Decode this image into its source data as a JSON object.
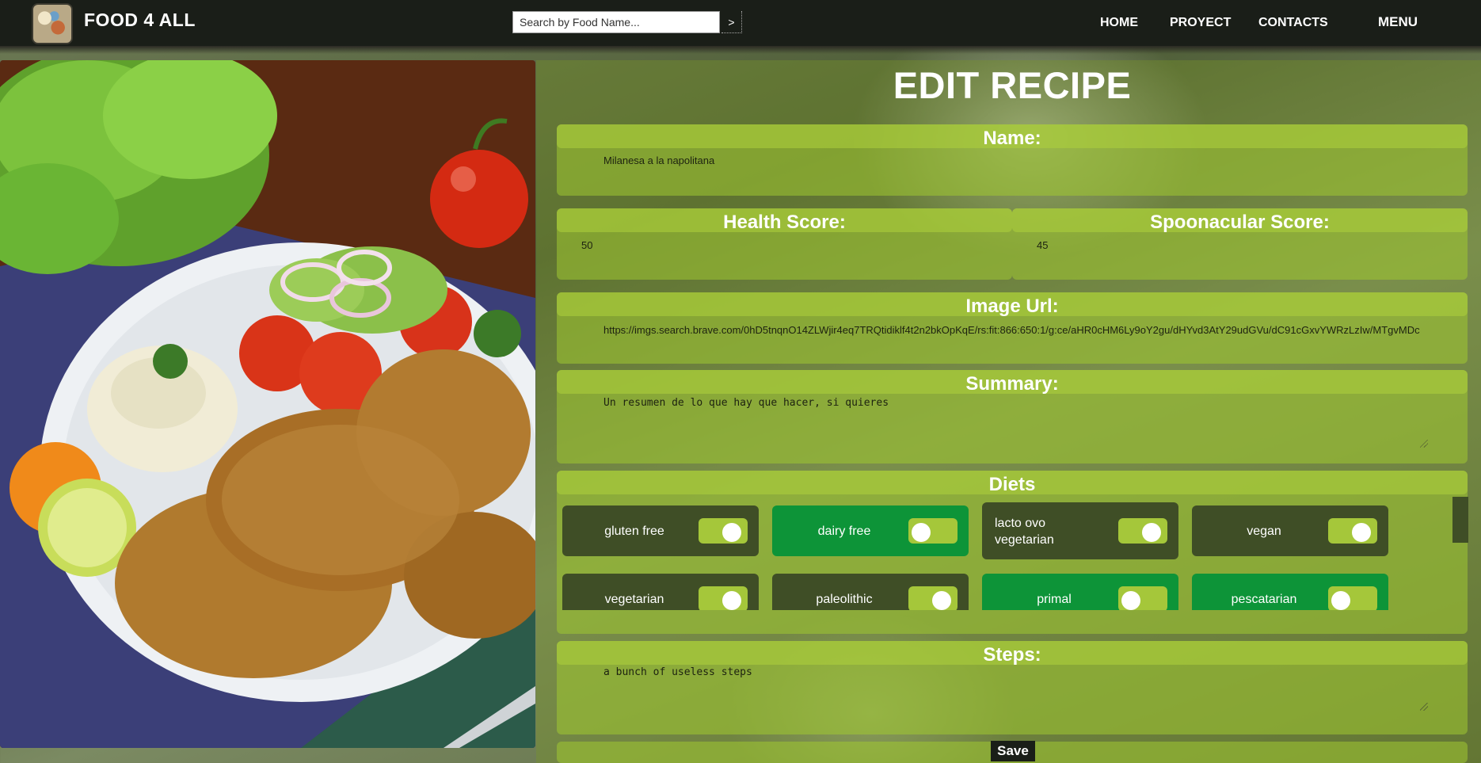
{
  "header": {
    "brand": "FOOD 4 ALL",
    "logo_icon": "food-logo-icon",
    "search": {
      "placeholder": "Search by Food Name...",
      "value": "",
      "button_label": ">"
    },
    "nav": [
      {
        "label": "HOME"
      },
      {
        "label": "PROYECT"
      },
      {
        "label": "CONTACTS"
      }
    ],
    "menu_label": "MENU"
  },
  "form": {
    "title": "EDIT RECIPE",
    "name": {
      "label": "Name:",
      "value": "Milanesa a la napolitana"
    },
    "health_score": {
      "label": "Health Score:",
      "value": "50"
    },
    "spoonacular_score": {
      "label": "Spoonacular Score:",
      "value": "45"
    },
    "image_url": {
      "label": "Image Url:",
      "value": "https://imgs.search.brave.com/0hD5tnqnO14ZLWjir4eq7TRQtidiklf4t2n2bkOpKqE/rs:fit:866:650:1/g:ce/aHR0cHM6Ly9oY2gu/dHYvd3AtY29udGVu/dC91cGxvYWRzLzIw/MTgvMDc"
    },
    "summary": {
      "label": "Summary:",
      "value": "Un resumen de lo que hay que hacer, si quieres"
    },
    "diets": {
      "label": "Diets",
      "items": [
        {
          "name": "gluten free",
          "checked": false
        },
        {
          "name": "dairy free",
          "checked": true
        },
        {
          "name": "lacto ovo vegetarian",
          "checked": false
        },
        {
          "name": "vegan",
          "checked": false
        },
        {
          "name": "vegetarian",
          "checked": false
        },
        {
          "name": "paleolithic",
          "checked": false
        },
        {
          "name": "primal",
          "checked": true
        },
        {
          "name": "pescatarian",
          "checked": true
        }
      ]
    },
    "steps": {
      "label": "Steps:",
      "value": "a bunch of useless steps"
    },
    "save_label": "Save"
  },
  "colors": {
    "navbar": "#1a1e18",
    "diet_off": "#3f4e26",
    "diet_on": "#0d9438",
    "toggle": "#a5c73a",
    "field": "#a0c832"
  }
}
